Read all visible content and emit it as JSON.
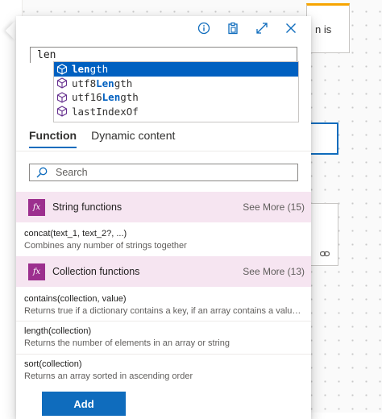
{
  "background": {
    "card_text": "n is",
    "link_icon": "link-icon"
  },
  "toolbar": {
    "info_icon": "info-icon",
    "clipboard_icon": "clipboard-icon",
    "expand_icon": "expand-icon",
    "close_icon": "close-icon"
  },
  "expression": {
    "value": "len"
  },
  "suggestions": [
    {
      "prefix": "",
      "match": "len",
      "suffix": "gth",
      "selected": true
    },
    {
      "prefix": "utf8",
      "match": "Len",
      "suffix": "gth",
      "selected": false
    },
    {
      "prefix": "utf16",
      "match": "Len",
      "suffix": "gth",
      "selected": false
    },
    {
      "prefix": "lastIndexOf",
      "match": "",
      "suffix": "",
      "selected": false
    }
  ],
  "tabs": [
    {
      "label": "Function",
      "active": true
    },
    {
      "label": "Dynamic content",
      "active": false
    }
  ],
  "search": {
    "placeholder": "Search"
  },
  "categories": [
    {
      "icon": "fx",
      "title": "String functions",
      "more": "See More (15)"
    },
    {
      "icon": "fx",
      "title": "Collection functions",
      "more": "See More (13)"
    }
  ],
  "functions": [
    {
      "signature": "concat(text_1, text_2?, ...)",
      "description": "Combines any number of strings together"
    },
    {
      "signature": "contains(collection, value)",
      "description": "Returns true if a dictionary contains a key, if an array contains a value, ..."
    },
    {
      "signature": "length(collection)",
      "description": "Returns the number of elements in an array or string"
    },
    {
      "signature": "sort(collection)",
      "description": "Returns an array sorted in ascending order"
    }
  ],
  "add_button": {
    "label": "Add"
  },
  "colors": {
    "accent": "#0f6cbd",
    "suggest_active": "#0060c0",
    "category_bg": "#f6e5f1",
    "fx_badge": "#9c2f8e"
  }
}
